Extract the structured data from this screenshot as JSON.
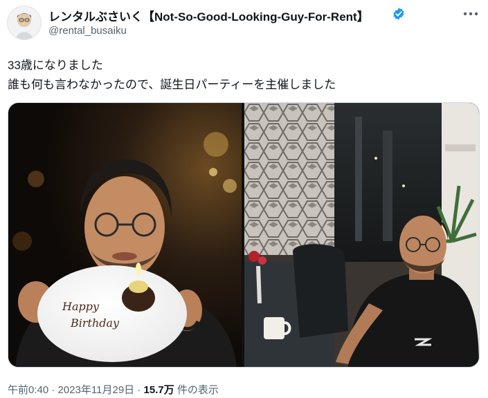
{
  "user": {
    "display_name": "レンタルぶさいく【Not-So-Good-Looking-Guy-For-Rent】",
    "handle": "@rental_busaiku",
    "verified_color": "#1d9bf0"
  },
  "tweet": {
    "lines": [
      "33歳になりました",
      "誰も何も言わなかったので、誕生日パーティーを主催しました"
    ]
  },
  "media": {
    "left_photo": "man-holding-birthday-cake-plate",
    "right_photo": "man-seated-at-restaurant-table",
    "plate_text_1": "Happy",
    "plate_text_2": "Birthday"
  },
  "meta": {
    "time": "午前0:40",
    "separator": "·",
    "date": "2023年11月29日",
    "views_count": "15.7万",
    "views_label": "件の表示"
  },
  "colors": {
    "text": "#0f1419",
    "secondary": "#536471",
    "accent": "#1d9bf0"
  }
}
